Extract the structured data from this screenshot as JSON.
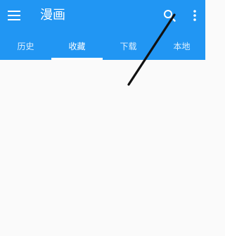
{
  "app_bar": {
    "title": "漫画",
    "background_color": "#2196f3",
    "icons": {
      "menu": "menu-icon",
      "search": "search-icon",
      "more": "more-vert-icon"
    }
  },
  "tabs": [
    {
      "label": "历史",
      "active": false
    },
    {
      "label": "收藏",
      "active": true
    },
    {
      "label": "下载",
      "active": false
    },
    {
      "label": "本地",
      "active": false
    }
  ],
  "annotation": {
    "color": "#111111"
  }
}
